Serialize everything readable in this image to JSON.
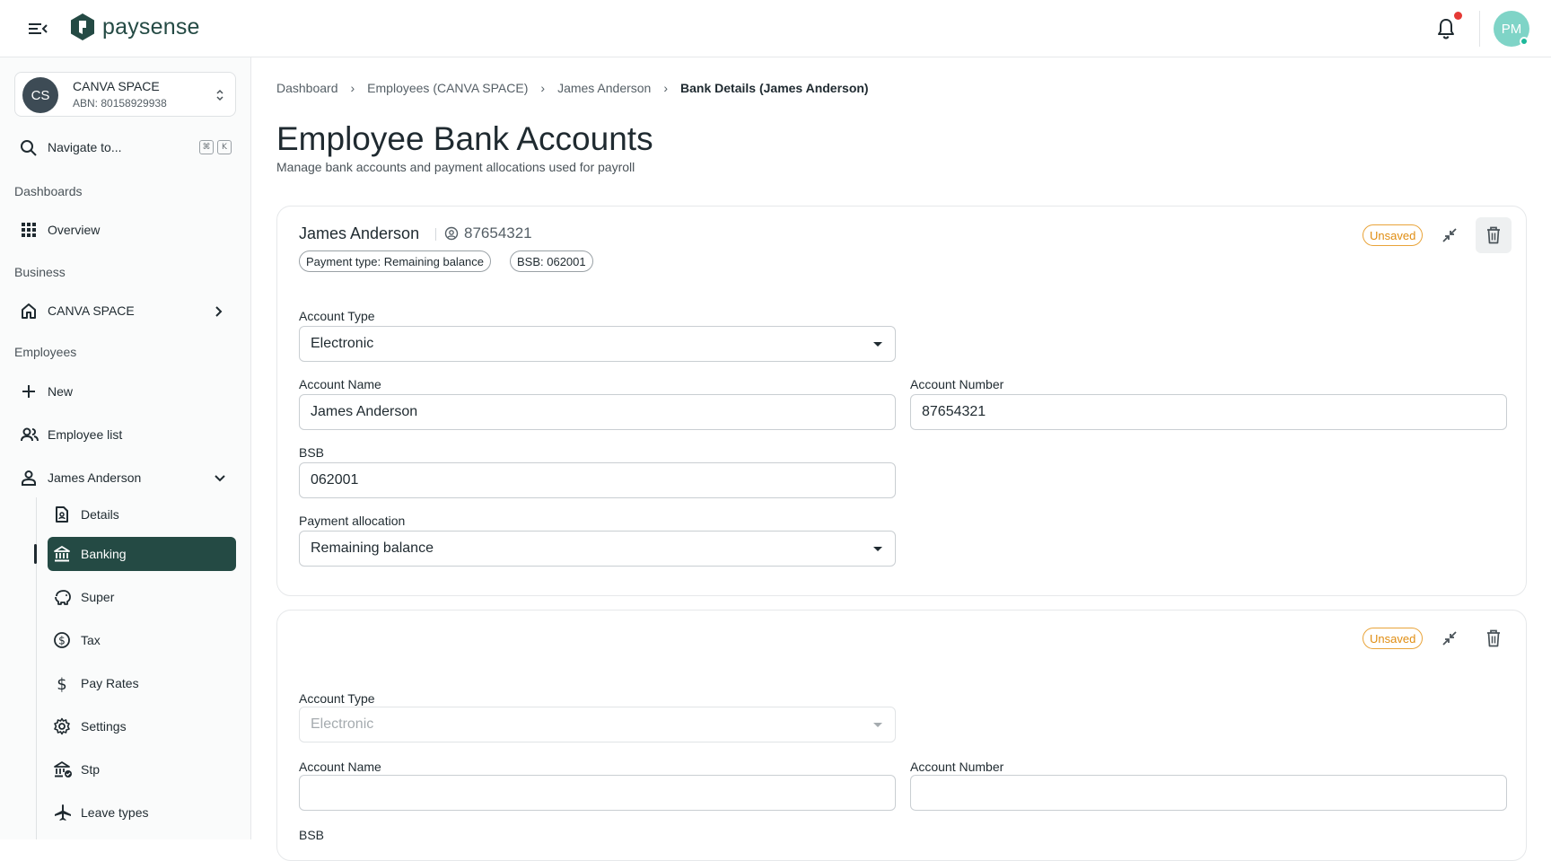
{
  "app": {
    "brand": "paysense",
    "user_initials": "PM"
  },
  "colors": {
    "brand": "#244a44",
    "accent_warning": "#e08d12",
    "notification": "#e53935",
    "status_online": "#1db89a",
    "avatar_user": "#7fd4c7"
  },
  "sidebar": {
    "org": {
      "initials": "CS",
      "name": "CANVA SPACE",
      "abn": "ABN: 80158929938"
    },
    "search": {
      "label": "Navigate to...",
      "kbd_1": "⌘",
      "kbd_2": "K"
    },
    "sections": {
      "dashboards": "Dashboards",
      "business": "Business",
      "employees": "Employees"
    },
    "items": {
      "overview": "Overview",
      "business_name": "CANVA SPACE",
      "new": "New",
      "employee_list": "Employee list",
      "employee_name": "James Anderson"
    },
    "sub_items": {
      "details": "Details",
      "banking": "Banking",
      "super": "Super",
      "tax": "Tax",
      "pay_rates": "Pay Rates",
      "settings": "Settings",
      "stp": "Stp",
      "leave_types": "Leave types"
    }
  },
  "breadcrumb": {
    "c1": "Dashboard",
    "c2": "Employees (CANVA SPACE)",
    "c3": "James Anderson",
    "c4": "Bank Details (James Anderson)"
  },
  "page": {
    "title": "Employee Bank Accounts",
    "subtitle": "Manage bank accounts and payment allocations used for payroll"
  },
  "card1": {
    "name": "James Anderson",
    "account_number_display": "87654321",
    "chip_payment": "Payment type: Remaining balance",
    "chip_bsb": "BSB: 062001",
    "status": "Unsaved",
    "labels": {
      "account_type": "Account Type",
      "account_name": "Account Name",
      "account_number": "Account Number",
      "bsb": "BSB",
      "payment_allocation": "Payment allocation"
    },
    "values": {
      "account_type": "Electronic",
      "account_name": "James Anderson",
      "account_number": "87654321",
      "bsb": "062001",
      "payment_allocation": "Remaining balance"
    }
  },
  "card2": {
    "status": "Unsaved",
    "labels": {
      "account_type": "Account Type",
      "account_name": "Account Name",
      "account_number": "Account Number",
      "bsb": "BSB"
    },
    "values": {
      "account_type": "Electronic",
      "account_name": "",
      "account_number": ""
    }
  }
}
